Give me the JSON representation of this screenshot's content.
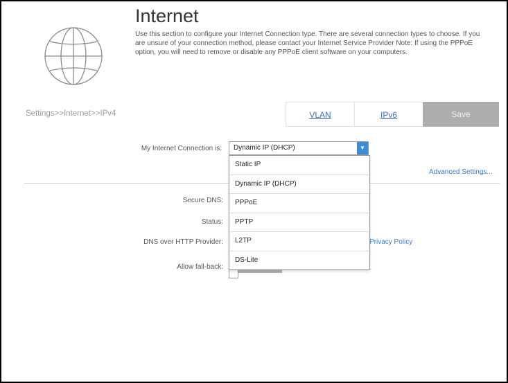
{
  "page": {
    "title": "Internet",
    "description": "Use this section to configure your Internet Connection type. There are several connection types to choose. If you are unsure of your connection method, please contact your Internet Service Provider Note: If using the PPPoE option, you will need to remove or disable any PPPoE client software on your computers.",
    "breadcrumb": "Settings>>Internet>>IPv4"
  },
  "tabs": {
    "vlan": "VLAN",
    "ipv6": "IPv6",
    "save": "Save"
  },
  "form": {
    "connection_label": "My Internet Connection is:",
    "connection_value": "Dynamic IP (DHCP)",
    "advanced_settings": "Advanced Settings...",
    "secure_dns_label": "Secure DNS:",
    "status_label": "Status:",
    "doh_provider_label": "DNS over HTTP Provider:",
    "allow_fallback_label": "Allow fall-back:",
    "privacy_policy": "Privacy Policy"
  },
  "dropdown": {
    "options": [
      "Static IP",
      "Dynamic IP (DHCP)",
      "PPPoE",
      "PPTP",
      "L2TP",
      "DS-Lite"
    ]
  },
  "colors": {
    "accent": "#3b8bd6",
    "link": "#3a6fbb",
    "save_bg": "#aeaeae"
  }
}
